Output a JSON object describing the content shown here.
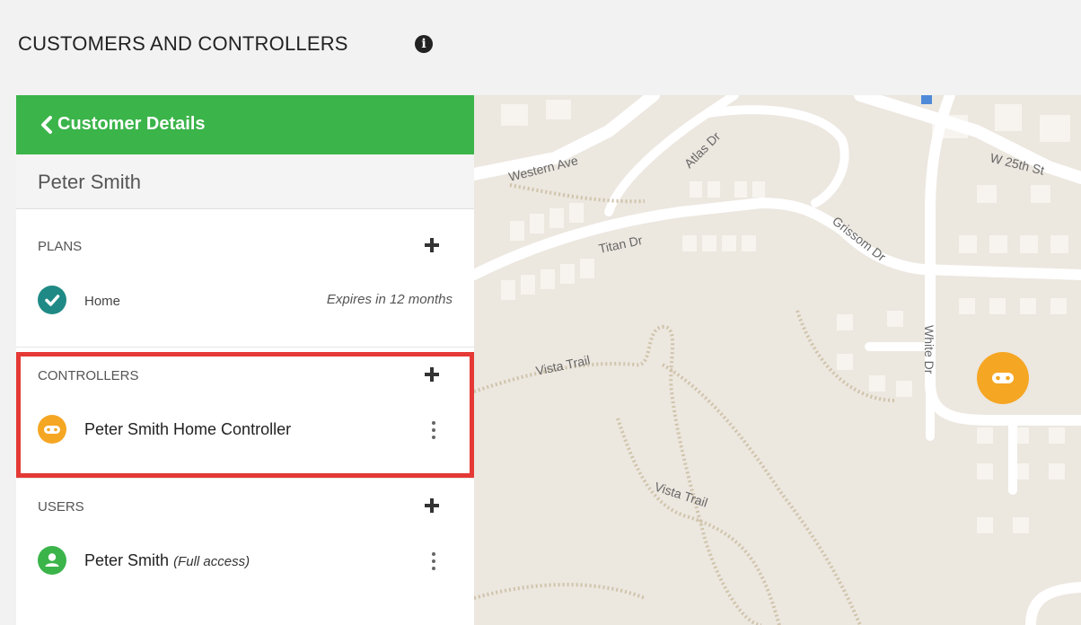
{
  "page": {
    "title": "CUSTOMERS AND CONTROLLERS",
    "info_icon": "info-circle-icon"
  },
  "panel": {
    "header_label": "Customer Details",
    "customer_name": "Peter Smith",
    "plans": {
      "label": "PLANS",
      "items": [
        {
          "name": "Home",
          "expiry": "Expires in 12 months",
          "icon": "check-circle-icon"
        }
      ]
    },
    "controllers": {
      "label": "CONTROLLERS",
      "items": [
        {
          "name": "Peter Smith Home Controller",
          "icon": "controller-icon"
        }
      ]
    },
    "users": {
      "label": "USERS",
      "items": [
        {
          "name": "Peter Smith",
          "access": "(Full access)",
          "icon": "user-icon"
        }
      ]
    }
  },
  "map": {
    "streets": [
      "Western Ave",
      "Atlas Dr",
      "Titan Dr",
      "Grissom Dr",
      "W 25th St",
      "White Dr",
      "Vista Trail",
      "Vista Trail"
    ],
    "marker_icon": "controller-icon"
  },
  "colors": {
    "header_green": "#3bb44a",
    "plan_teal": "#1f8a85",
    "controller_orange": "#f5a623",
    "user_green": "#3bb44a",
    "highlight_red": "#e53935",
    "map_background": "#ece7df"
  }
}
